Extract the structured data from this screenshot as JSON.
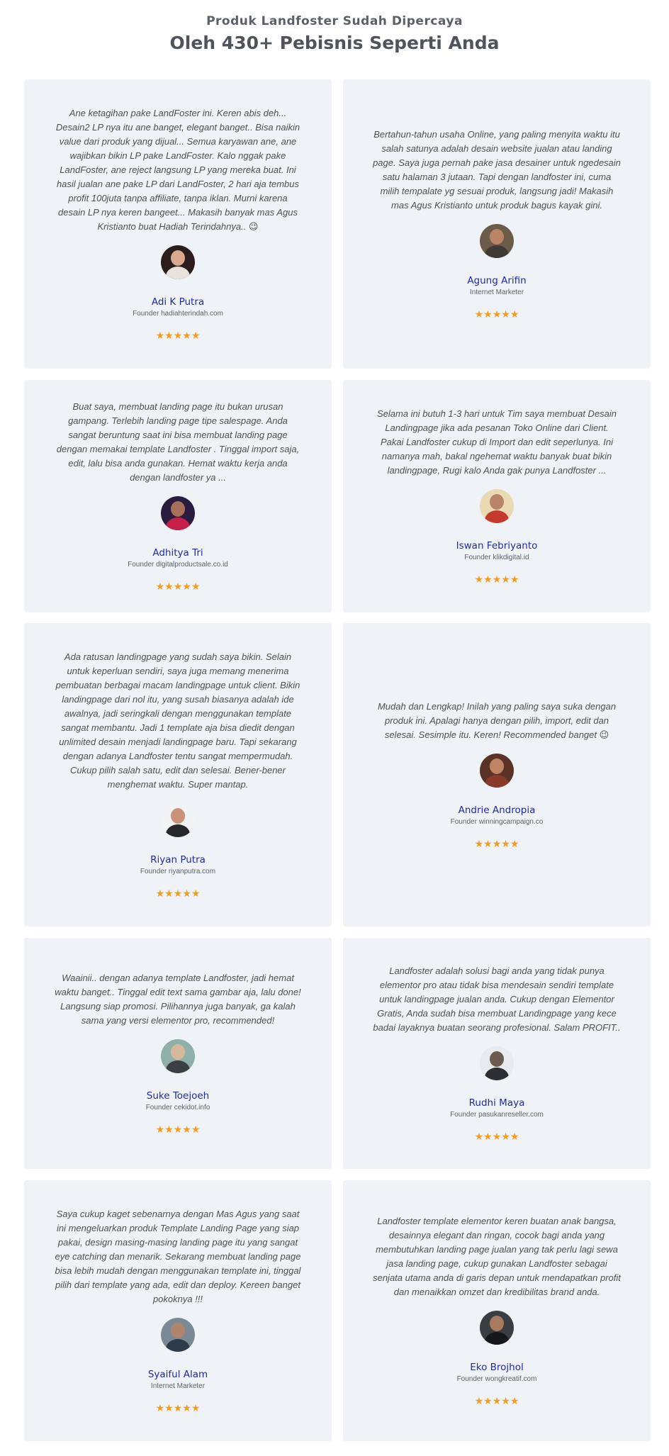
{
  "header": {
    "subtitle": "Produk Landfoster Sudah Dipercaya",
    "title": "Oleh 430+ Pebisnis Seperti Anda"
  },
  "rating_stars": "★★★★★",
  "testimonials": [
    {
      "quote": "Ane ketagihan pake LandFoster ini. Keren abis deh... Desain2 LP nya itu ane banget, elegant banget.. Bisa naikin value dari produk yang dijual... Semua karyawan ane, ane wajibkan bikin LP pake LandFoster. Kalo nggak pake LandFoster, ane reject langsung LP yang mereka buat. Ini hasil jualan ane pake LP dari LandFoster, 2 hari aja tembus profit 100juta tanpa affiliate, tanpa iklan. Murni karena desain LP nya keren bangeet... Makasih banyak mas Agus Kristianto buat Hadiah Terindahnya.. 😉",
      "name": "Adi K Putra",
      "role": "Founder hadiahterindah.com",
      "avatar_bg": "#2b1d1b",
      "avatar_face": "#d9a98f",
      "avatar_body": "#e8e2dc"
    },
    {
      "quote": "Bertahun-tahun usaha Online, yang paling menyita waktu itu salah satunya adalah desain website jualan atau landing page. Saya juga pernah pake jasa desainer untuk ngedesain satu halaman 3 jutaan. Tapi dengan landfoster ini, cuma milih tempalate yg sesuai produk, langsung jadi! Makasih mas Agus Kristianto untuk produk bagus kayak gini.",
      "name": "Agung Arifin",
      "role": "Internet Marketer",
      "avatar_bg": "#6c5b48",
      "avatar_face": "#b98467",
      "avatar_body": "#3f3a36"
    },
    {
      "quote": "Buat saya, membuat landing page itu bukan urusan gampang. Terlebih landing page tipe salespage. Anda sangat beruntung saat ini bisa membuat landing page dengan memakai template Landfoster . Tinggal import saja, edit, lalu bisa anda gunakan. Hemat waktu kerja anda dengan landfoster ya ...",
      "name": "Adhitya Tri",
      "role": "Founder digitalproductsale.co.id",
      "avatar_bg": "#2a1c3f",
      "avatar_face": "#a8705a",
      "avatar_body": "#c4204a"
    },
    {
      "quote": "Selama ini butuh 1-3 hari untuk Tim saya membuat Desain Landingpage jika ada pesanan Toko Online dari Client. Pakai Landfoster cukup di Import dan edit seperlunya. Ini namanya mah, bakal ngehemat waktu banyak buat bikin landingpage, Rugi kalo Anda gak punya Landfoster ...",
      "name": "Iswan Febriyanto",
      "role": "Founder klikdigital.id",
      "avatar_bg": "#ead9b3",
      "avatar_face": "#b98467",
      "avatar_body": "#c63a2e"
    },
    {
      "quote": "Ada ratusan landingpage yang sudah saya bikin. Selain untuk keperluan sendiri, saya juga memang menerima pembuatan berbagai macam landingpage untuk client. Bikin landingpage dari nol itu, yang susah biasanya adalah ide awalnya, jadi seringkali dengan menggunakan template sangat membantu. Jadi 1 template aja bisa diedit dengan unlimited desain menjadi landingpage baru. Tapi sekarang dengan adanya Landfoster tentu sangat mempermudah. Cukup pilih salah satu, edit dan selesai. Bener-bener menghemat waktu. Super mantap.",
      "name": "Riyan Putra",
      "role": "Founder riyanputra.com",
      "avatar_bg": "#f1f3f5",
      "avatar_face": "#c89378",
      "avatar_body": "#26272b"
    },
    {
      "quote": "Mudah dan Lengkap! Inilah yang paling saya suka dengan produk ini. Apalagi hanya dengan pilih, import, edit dan selesai. Sesimple itu. Keren! Recommended banget 😉",
      "name": "Andrie Andropia",
      "role": "Founder winningcampaign.co",
      "avatar_bg": "#5a3226",
      "avatar_face": "#c08465",
      "avatar_body": "#8a3a2a"
    },
    {
      "quote": "Waainii.. dengan adanya template Landfoster, jadi hemat waktu banget.. Tinggal edit text sama gambar aja, lalu done! Langsung siap promosi. Pilihannya juga banyak, ga kalah sama yang versi elementor pro, recommended!",
      "name": "Suke Toejoeh",
      "role": "Founder cekidot.info",
      "avatar_bg": "#8fb0a8",
      "avatar_face": "#d7b89c",
      "avatar_body": "#3b3f46"
    },
    {
      "quote": "Landfoster adalah solusi bagi anda yang tidak punya elementor pro atau tidak bisa mendesain sendiri template untuk landingpage jualan anda. Cukup dengan Elementor Gratis, Anda sudah bisa membuat Landingpage yang kece badai layaknya buatan seorang profesional. Salam PROFIT..",
      "name": "Rudhi Maya",
      "role": "Founder pasukanreseller.com",
      "avatar_bg": "#e7eaee",
      "avatar_face": "#6b5a4d",
      "avatar_body": "#2c2e33"
    },
    {
      "quote": "Saya cukup kaget sebenarnya dengan Mas Agus yang saat ini mengeluarkan produk Template Landing Page yang siap pakai, design masing-masing landing page itu yang sangat eye catching dan menarik. Sekarang membuat landing page bisa lebih mudah dengan menggunakan template ini, tinggal pilih dari template yang ada, edit dan deploy. Kereen banget pokoknya !!!",
      "name": "Syaiful Alam",
      "role": "Internet Marketer",
      "avatar_bg": "#7a8a95",
      "avatar_face": "#b0846a",
      "avatar_body": "#2f3b4a"
    },
    {
      "quote": "Landfoster template elementor keren buatan anak bangsa, desainnya elegant dan ringan, cocok bagi anda yang membutuhkan landing page jualan yang tak perlu lagi sewa jasa landing page, cukup gunakan Landfoster sebagai senjata utama anda di garis depan untuk mendapatkan profit dan menaikkan omzet dan kredibilitas brand anda.",
      "name": "Eko Brojhol",
      "role": "Founder wongkreatif.com",
      "avatar_bg": "#3a3d42",
      "avatar_face": "#a87a5f",
      "avatar_body": "#16171a"
    }
  ]
}
